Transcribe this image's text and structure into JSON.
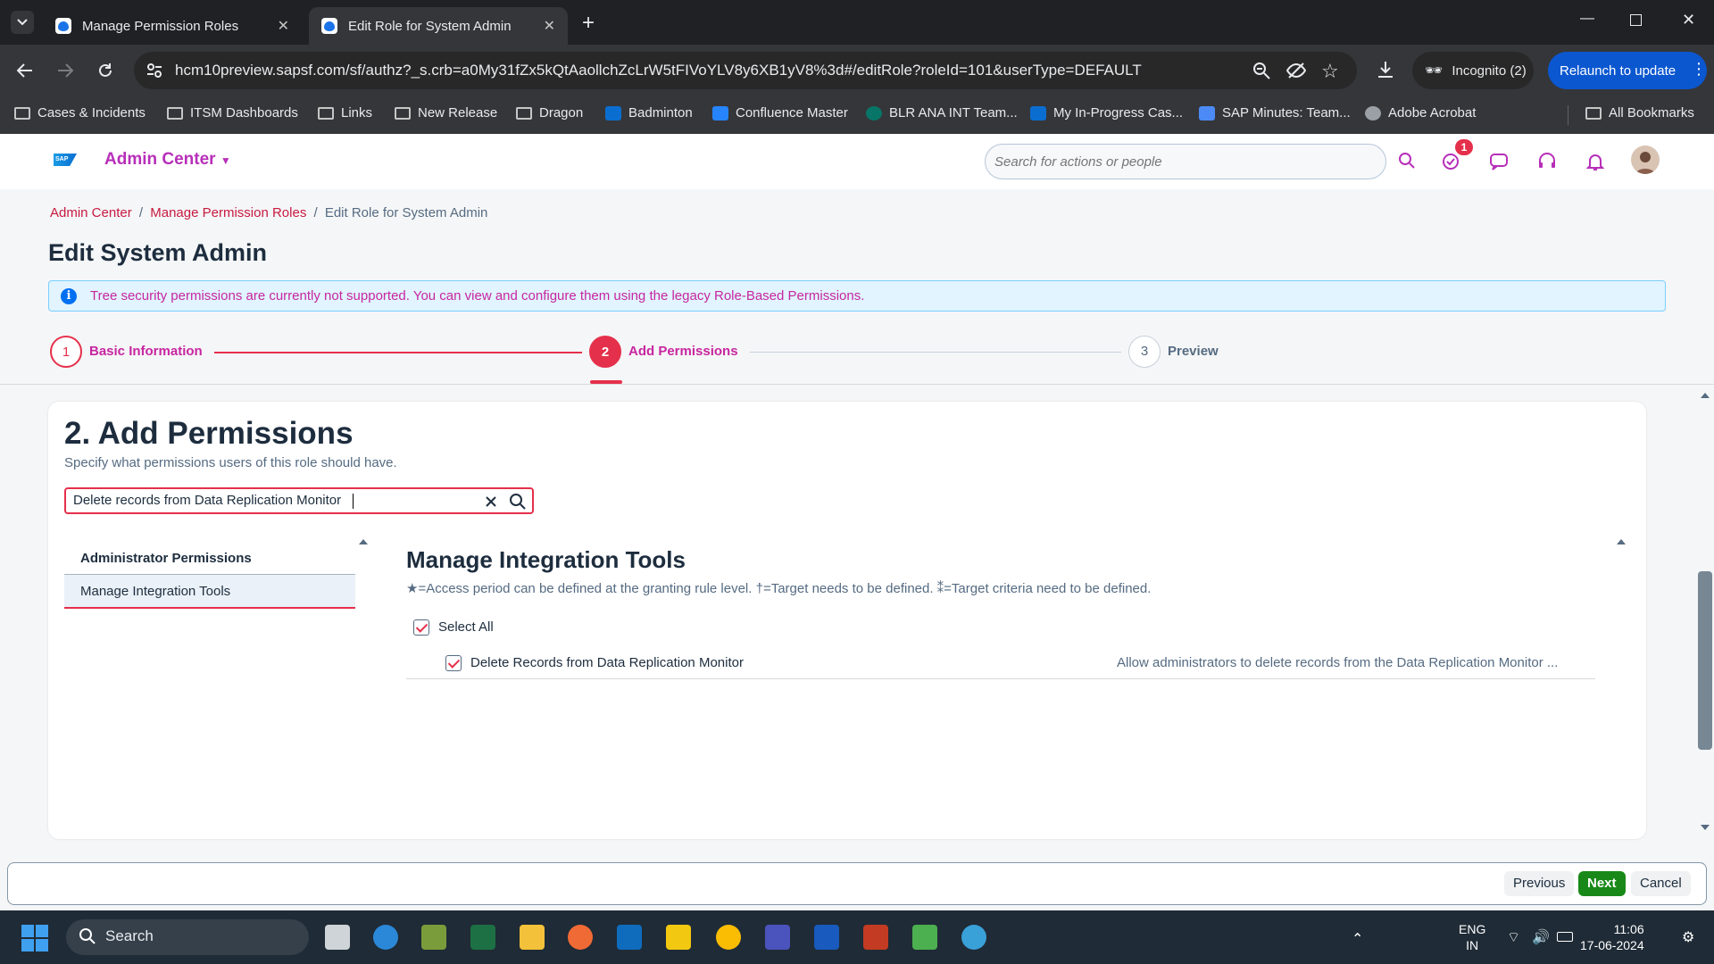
{
  "browser": {
    "tabs": [
      {
        "title": "Manage Permission Roles",
        "active": false
      },
      {
        "title": "Edit Role for System Admin",
        "active": true
      }
    ],
    "url": "hcm10preview.sapsf.com/sf/authz?_s.crb=a0My31fZx5kQtAaollchZcLrW5tFIVoYLV8y6XB1yV8%3d#/editRole?roleId=101&userType=DEFAULT",
    "incognito_label": "Incognito (2)",
    "relaunch_label": "Relaunch to update",
    "bookmarks": [
      "Cases & Incidents",
      "ITSM Dashboards",
      "Links",
      "New Release",
      "Dragon",
      "Badminton",
      "Confluence Master",
      "BLR ANA INT Team...",
      "My In-Progress Cas...",
      "SAP Minutes: Team...",
      "Adobe Acrobat",
      "All Bookmarks"
    ]
  },
  "shell": {
    "app_title": "Admin Center",
    "search_placeholder": "Search for actions or people",
    "notification_badge": "1"
  },
  "breadcrumb": {
    "item1": "Admin Center",
    "sep": "/",
    "item2": "Manage Permission Roles",
    "current": "Edit Role for System Admin"
  },
  "page_title": "Edit System Admin",
  "info_message": "Tree security permissions are currently not supported. You can view and configure them using the legacy Role-Based Permissions.",
  "stepper": [
    {
      "num": "1",
      "label": "Basic Information"
    },
    {
      "num": "2",
      "label": "Add Permissions"
    },
    {
      "num": "3",
      "label": "Preview"
    }
  ],
  "section": {
    "title": "2. Add Permissions",
    "subtitle": "Specify what permissions users of this role should have.",
    "search_value": "Delete records from Data Replication Monitor"
  },
  "left_nav": {
    "header": "Administrator Permissions",
    "items": [
      "Manage Integration Tools"
    ]
  },
  "right_panel": {
    "title": "Manage Integration Tools",
    "legend": "★=Access period can be defined at the granting rule level.   †=Target needs to be defined.   ⁑=Target criteria need to be defined.",
    "select_all": "Select All",
    "permissions": [
      {
        "label": "Delete Records from Data Replication Monitor",
        "description": "Allow administrators to delete records from the Data Replication Monitor ...",
        "checked": true
      }
    ]
  },
  "footer": {
    "previous": "Previous",
    "next": "Next",
    "cancel": "Cancel"
  },
  "taskbar": {
    "search_label": "Search",
    "lang_line1": "ENG",
    "lang_line2": "IN",
    "time": "11:06",
    "date": "17-06-2024"
  }
}
